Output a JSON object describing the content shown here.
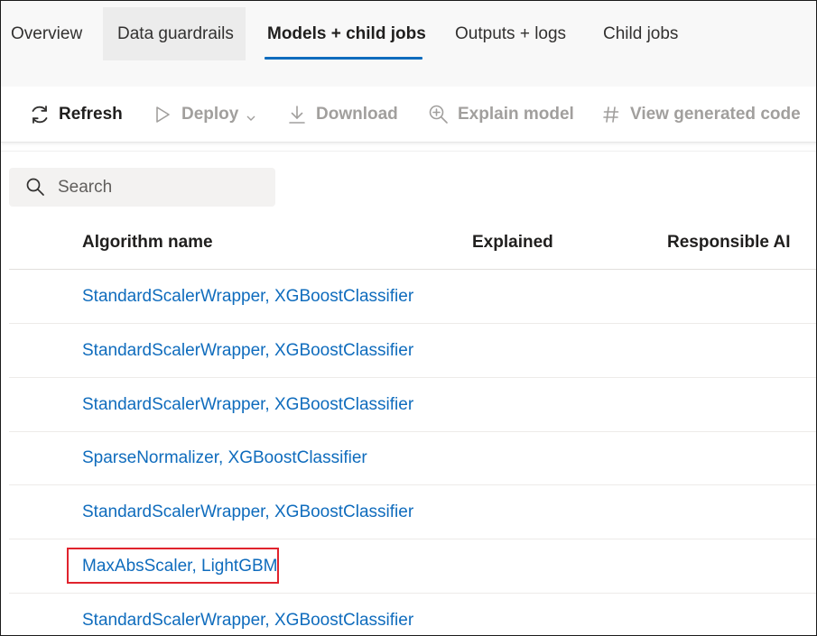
{
  "tabs": [
    {
      "label": "Overview"
    },
    {
      "label": "Data guardrails"
    },
    {
      "label": "Models + child jobs"
    },
    {
      "label": "Outputs + logs"
    },
    {
      "label": "Child jobs"
    }
  ],
  "active_tab": "Models + child jobs",
  "toolbar": {
    "refresh": "Refresh",
    "deploy": "Deploy",
    "download": "Download",
    "explain_model": "Explain model",
    "view_generated_code": "View generated code"
  },
  "search": {
    "placeholder": "Search",
    "value": ""
  },
  "table": {
    "columns": [
      "Algorithm name",
      "Explained",
      "Responsible AI"
    ],
    "rows": [
      {
        "algorithm": "StandardScalerWrapper, XGBoostClassifier",
        "explained": "",
        "responsible_ai": ""
      },
      {
        "algorithm": "StandardScalerWrapper, XGBoostClassifier",
        "explained": "",
        "responsible_ai": ""
      },
      {
        "algorithm": "StandardScalerWrapper, XGBoostClassifier",
        "explained": "",
        "responsible_ai": ""
      },
      {
        "algorithm": "SparseNormalizer, XGBoostClassifier",
        "explained": "",
        "responsible_ai": ""
      },
      {
        "algorithm": "StandardScalerWrapper, XGBoostClassifier",
        "explained": "",
        "responsible_ai": ""
      },
      {
        "algorithm": "MaxAbsScaler, LightGBM",
        "explained": "",
        "responsible_ai": ""
      },
      {
        "algorithm": "StandardScalerWrapper, XGBoostClassifier",
        "explained": "",
        "responsible_ai": ""
      }
    ]
  },
  "icons": {
    "refresh": "refresh-icon",
    "deploy": "play-icon",
    "deploy_menu": "chevron-down-icon",
    "download": "download-icon",
    "explain": "zoom-in-icon",
    "code": "hash-icon",
    "search": "search-icon"
  },
  "colors": {
    "accent": "#0f6cbd",
    "link": "#0f6cbd",
    "highlight_border": "#e0232d",
    "disabled_text": "#a19f9d"
  }
}
